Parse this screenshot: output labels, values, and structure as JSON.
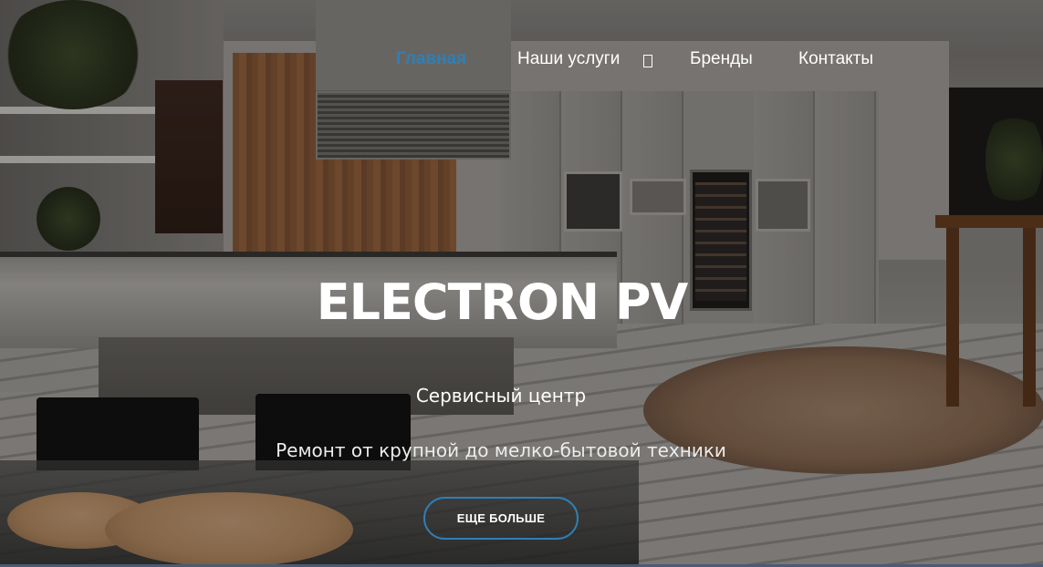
{
  "nav": {
    "items": [
      {
        "label": "Главная",
        "active": true
      },
      {
        "label": "Наши услуги",
        "has_dropdown": true
      },
      {
        "label": "Бренды"
      },
      {
        "label": "Контакты"
      }
    ],
    "dropdown_icon": "chevron-down-icon",
    "active_color": "#2f7fb6"
  },
  "hero": {
    "title": "ELECTRON PV",
    "subtitle": "Сервисный центр",
    "description": "Ремонт от крупной до мелко-бытовой техники",
    "cta_label": "ЕЩЕ БОЛЬШЕ",
    "cta_border_color": "#2f7fb6"
  }
}
